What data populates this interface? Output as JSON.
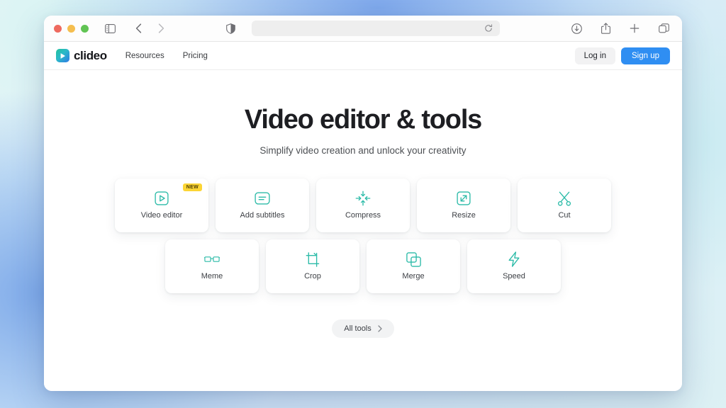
{
  "browser": {
    "window_controls": [
      "close",
      "minimize",
      "maximize"
    ],
    "address_bar_value": "",
    "address_bar_placeholder": "",
    "icons": {
      "sidebar": "sidebar-icon",
      "back": "chevron-left-icon",
      "forward": "chevron-right-icon",
      "privacy": "shield-icon",
      "reload": "reload-icon",
      "downloads": "download-icon",
      "share": "share-icon",
      "new_tab": "plus-icon",
      "tab_overview": "tabs-icon"
    }
  },
  "site": {
    "logo_text": "clideo",
    "nav": [
      {
        "label": "Resources"
      },
      {
        "label": "Pricing"
      }
    ],
    "login_label": "Log in",
    "signup_label": "Sign up",
    "accent_blue": "#2f8ef2",
    "accent_teal": "#2cbba8",
    "badge_yellow": "#fcd535"
  },
  "hero": {
    "title": "Video editor & tools",
    "subtitle": "Simplify video creation and unlock your creativity"
  },
  "tools": {
    "row1": [
      {
        "label": "Video editor",
        "icon": "play-square-icon",
        "badge": "NEW"
      },
      {
        "label": "Add subtitles",
        "icon": "subtitles-icon",
        "badge": ""
      },
      {
        "label": "Compress",
        "icon": "compress-arrows-icon",
        "badge": ""
      },
      {
        "label": "Resize",
        "icon": "resize-expand-icon",
        "badge": ""
      },
      {
        "label": "Cut",
        "icon": "scissors-icon",
        "badge": ""
      }
    ],
    "row2": [
      {
        "label": "Meme",
        "icon": "glasses-icon",
        "badge": ""
      },
      {
        "label": "Crop",
        "icon": "crop-icon",
        "badge": ""
      },
      {
        "label": "Merge",
        "icon": "merge-squares-icon",
        "badge": ""
      },
      {
        "label": "Speed",
        "icon": "lightning-bolt-icon",
        "badge": ""
      }
    ]
  },
  "all_tools": {
    "label": "All tools",
    "chevron": "chevron-right-icon"
  }
}
